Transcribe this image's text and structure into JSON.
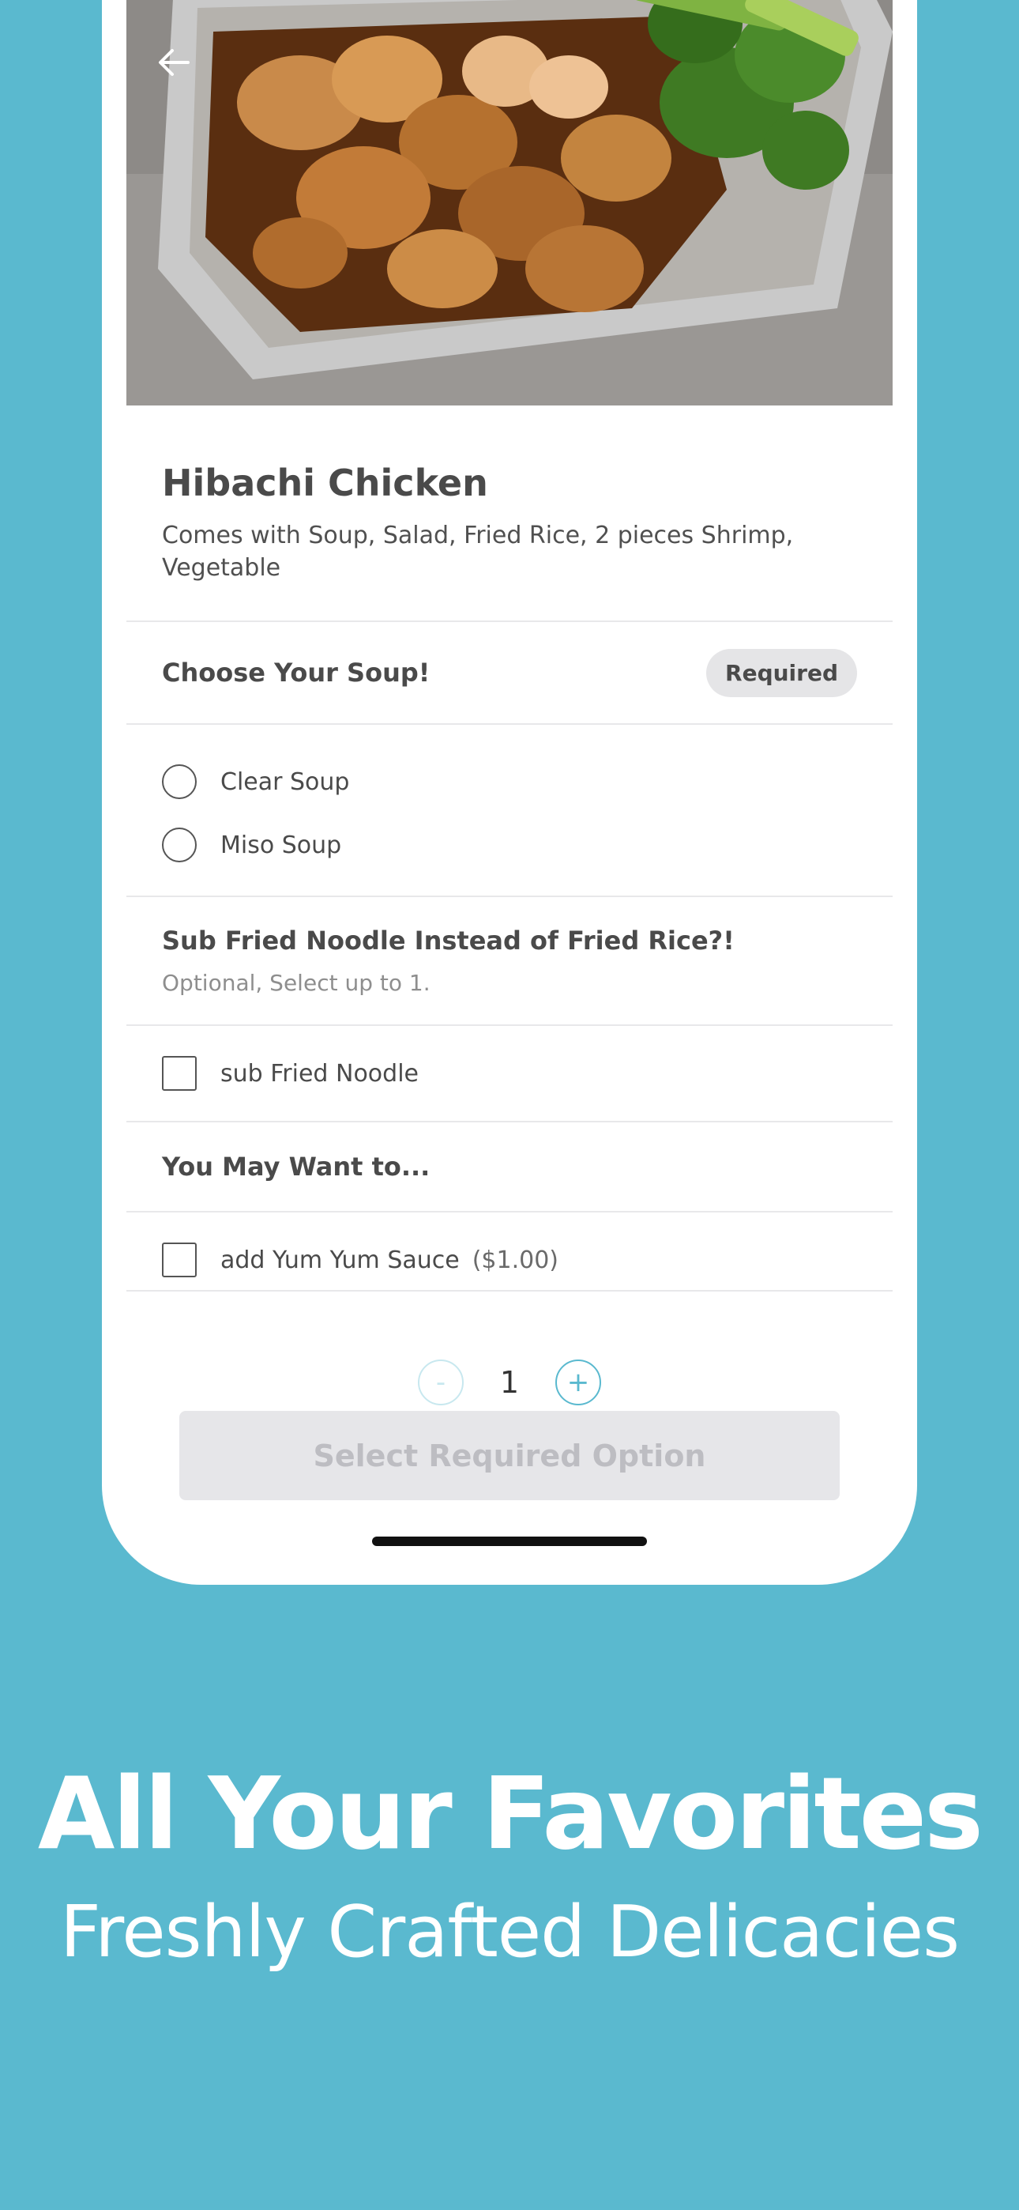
{
  "item": {
    "title": "Hibachi Chicken",
    "description": "Comes with Soup, Salad, Fried Rice, 2 pieces Shrimp, Vegetable"
  },
  "soup_section": {
    "title": "Choose Your Soup!",
    "badge": "Required",
    "options": [
      {
        "label": "Clear Soup"
      },
      {
        "label": "Miso Soup"
      }
    ]
  },
  "noodle_section": {
    "title": "Sub Fried Noodle Instead of Fried Rice?!",
    "subtitle": "Optional, Select up to 1.",
    "options": [
      {
        "label": "sub Fried Noodle"
      }
    ]
  },
  "extras_section": {
    "title": "You May Want to...",
    "options": [
      {
        "label": "add Yum Yum Sauce",
        "price": "($1.00)"
      }
    ]
  },
  "quantity": {
    "minus_label": "-",
    "value": "1",
    "plus_label": "+"
  },
  "cta": {
    "label": "Select Required Option"
  },
  "marketing": {
    "headline": "All Your Favorites",
    "subheadline": "Freshly Crafted Delicacies"
  },
  "icons": {
    "back": "arrow-left-icon",
    "food_photo": "hibachi-chicken-photo"
  },
  "colors": {
    "background": "#5ab9cf",
    "accent": "#5ab9cf",
    "cta_disabled_bg": "#e6e6e9",
    "cta_disabled_text": "#bdbdc2"
  }
}
